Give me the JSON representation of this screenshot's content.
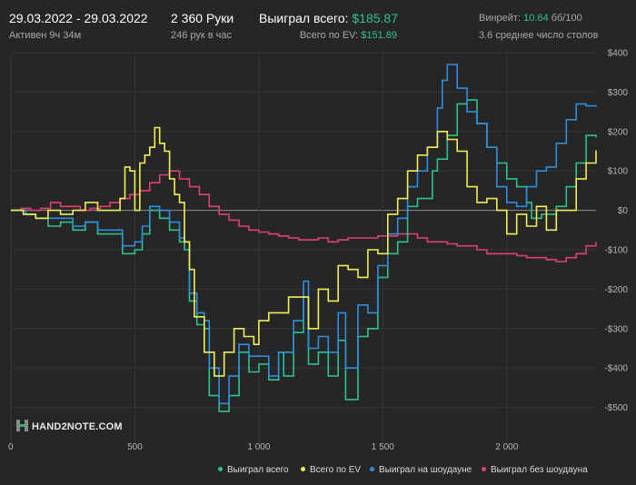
{
  "header": {
    "date_range": "29.03.2022 - 29.03.2022",
    "active_time": "Активен 9ч 34м",
    "hands": "2 360 Руки",
    "hands_per_hour": "246 рук в час",
    "won_total_label": "Выиграл всего:",
    "won_total_value": "$185.87",
    "ev_label": "Всего по EV:",
    "ev_value": "$151.89",
    "winrate_label": "Винрейт:",
    "winrate_value": "10.64",
    "winrate_unit": "бб/100",
    "avg_tables": "3.6 среднее число столов"
  },
  "logo": {
    "text": "HAND2NOTE.COM",
    "mark": "H"
  },
  "colors": {
    "background": "#262626",
    "won_total": "#2dc489",
    "ev": "#f2ee55",
    "showdown": "#2e8fdf",
    "non_showdown": "#e0406f",
    "positive_text": "#2dc489"
  },
  "chart_data": {
    "type": "line",
    "x_ticks": [
      0,
      500,
      1000,
      1500,
      2000
    ],
    "x_tick_labels": [
      "0",
      "500",
      "1 000",
      "1 500",
      "2 000"
    ],
    "y_ticks": [
      400,
      300,
      200,
      100,
      0,
      -100,
      -200,
      -300,
      -400,
      -500
    ],
    "y_tick_labels": [
      "$400",
      "$300",
      "$200",
      "$100",
      "$0",
      "-$100",
      "-$200",
      "-$300",
      "-$400",
      "-$500"
    ],
    "xlim": [
      0,
      2360
    ],
    "ylim": [
      -540,
      400
    ],
    "grid": true,
    "legend_position": "bottom-right",
    "series": [
      {
        "name": "Выиграл всего",
        "color": "#2dc489",
        "x": [
          0,
          60,
          100,
          150,
          200,
          250,
          300,
          350,
          400,
          450,
          500,
          530,
          560,
          600,
          640,
          680,
          700,
          720,
          750,
          780,
          800,
          840,
          880,
          920,
          960,
          1000,
          1040,
          1080,
          1100,
          1140,
          1180,
          1200,
          1240,
          1280,
          1320,
          1350,
          1400,
          1440,
          1480,
          1520,
          1560,
          1600,
          1640,
          1700,
          1720,
          1760,
          1800,
          1840,
          1880,
          1920,
          1960,
          2000,
          2040,
          2080,
          2100,
          2140,
          2200,
          2240,
          2280,
          2320,
          2360
        ],
        "y": [
          0,
          -10,
          -20,
          -40,
          -30,
          -50,
          -30,
          -60,
          -60,
          -110,
          -100,
          -60,
          0,
          -20,
          -50,
          -80,
          -100,
          -230,
          -290,
          -300,
          -470,
          -510,
          -470,
          -360,
          -410,
          -390,
          -430,
          -360,
          -420,
          -310,
          -220,
          -390,
          -360,
          -420,
          -330,
          -480,
          -320,
          -300,
          -170,
          -110,
          -80,
          10,
          30,
          100,
          130,
          190,
          270,
          280,
          220,
          160,
          120,
          80,
          60,
          20,
          -20,
          -10,
          10,
          60,
          120,
          190,
          185
        ]
      },
      {
        "name": "Всего по EV",
        "color": "#f2ee55",
        "x": [
          0,
          50,
          100,
          150,
          200,
          250,
          300,
          350,
          400,
          440,
          460,
          480,
          500,
          520,
          540,
          560,
          580,
          600,
          620,
          640,
          660,
          680,
          700,
          720,
          740,
          780,
          820,
          860,
          900,
          940,
          980,
          1000,
          1040,
          1080,
          1120,
          1160,
          1200,
          1240,
          1280,
          1320,
          1360,
          1400,
          1440,
          1480,
          1520,
          1560,
          1600,
          1640,
          1680,
          1720,
          1760,
          1800,
          1840,
          1880,
          1920,
          1960,
          2000,
          2040,
          2080,
          2120,
          2160,
          2200,
          2240,
          2280,
          2320,
          2360
        ],
        "y": [
          0,
          -10,
          -20,
          0,
          -10,
          0,
          20,
          0,
          0,
          30,
          110,
          100,
          0,
          120,
          140,
          160,
          210,
          170,
          150,
          80,
          40,
          20,
          -80,
          -150,
          -270,
          -360,
          -420,
          -360,
          -300,
          -320,
          -340,
          -280,
          -260,
          -260,
          -220,
          -220,
          -300,
          -200,
          -230,
          -140,
          -150,
          -170,
          -100,
          -110,
          -10,
          30,
          100,
          140,
          160,
          200,
          180,
          150,
          60,
          20,
          30,
          0,
          -60,
          -10,
          -40,
          10,
          -50,
          0,
          0,
          80,
          120,
          152
        ]
      },
      {
        "name": "Выиграл на шоудауне",
        "color": "#2e8fdf",
        "x": [
          0,
          60,
          100,
          150,
          200,
          250,
          300,
          350,
          400,
          450,
          500,
          530,
          560,
          600,
          640,
          680,
          700,
          720,
          750,
          780,
          800,
          840,
          880,
          920,
          960,
          1000,
          1040,
          1080,
          1100,
          1140,
          1180,
          1200,
          1240,
          1280,
          1320,
          1350,
          1400,
          1440,
          1480,
          1520,
          1560,
          1600,
          1640,
          1680,
          1720,
          1740,
          1760,
          1800,
          1840,
          1880,
          1920,
          1960,
          2000,
          2040,
          2080,
          2120,
          2160,
          2200,
          2240,
          2280,
          2320,
          2360
        ],
        "y": [
          0,
          -10,
          -20,
          -20,
          -20,
          -40,
          -30,
          -50,
          -50,
          -90,
          -80,
          -40,
          10,
          0,
          -30,
          -70,
          -80,
          -210,
          -260,
          -280,
          -400,
          -490,
          -420,
          -340,
          -370,
          -370,
          -420,
          -360,
          -360,
          -280,
          -180,
          -350,
          -320,
          -360,
          -260,
          -400,
          -240,
          -260,
          -140,
          -60,
          -20,
          60,
          100,
          160,
          260,
          330,
          370,
          310,
          250,
          220,
          160,
          60,
          20,
          10,
          60,
          100,
          110,
          170,
          230,
          270,
          265,
          263
        ]
      },
      {
        "name": "Выиграл без шоудауна",
        "color": "#e0406f",
        "x": [
          0,
          40,
          80,
          120,
          160,
          200,
          240,
          280,
          320,
          360,
          400,
          440,
          480,
          520,
          560,
          600,
          640,
          680,
          720,
          760,
          800,
          840,
          880,
          920,
          960,
          1000,
          1040,
          1080,
          1120,
          1160,
          1200,
          1240,
          1280,
          1320,
          1360,
          1400,
          1440,
          1480,
          1520,
          1560,
          1600,
          1640,
          1680,
          1720,
          1760,
          1800,
          1840,
          1880,
          1920,
          1960,
          2000,
          2040,
          2080,
          2120,
          2160,
          2200,
          2240,
          2280,
          2320,
          2360
        ],
        "y": [
          0,
          5,
          0,
          5,
          20,
          10,
          10,
          0,
          5,
          10,
          20,
          30,
          40,
          50,
          70,
          90,
          100,
          80,
          60,
          40,
          10,
          -10,
          -25,
          -40,
          -50,
          -55,
          -60,
          -65,
          -70,
          -75,
          -75,
          -70,
          -80,
          -75,
          -70,
          -70,
          -70,
          -65,
          -65,
          -60,
          -60,
          -70,
          -80,
          -80,
          -85,
          -90,
          -90,
          -100,
          -110,
          -110,
          -110,
          -115,
          -120,
          -120,
          -125,
          -130,
          -120,
          -110,
          -90,
          -80
        ]
      }
    ]
  }
}
